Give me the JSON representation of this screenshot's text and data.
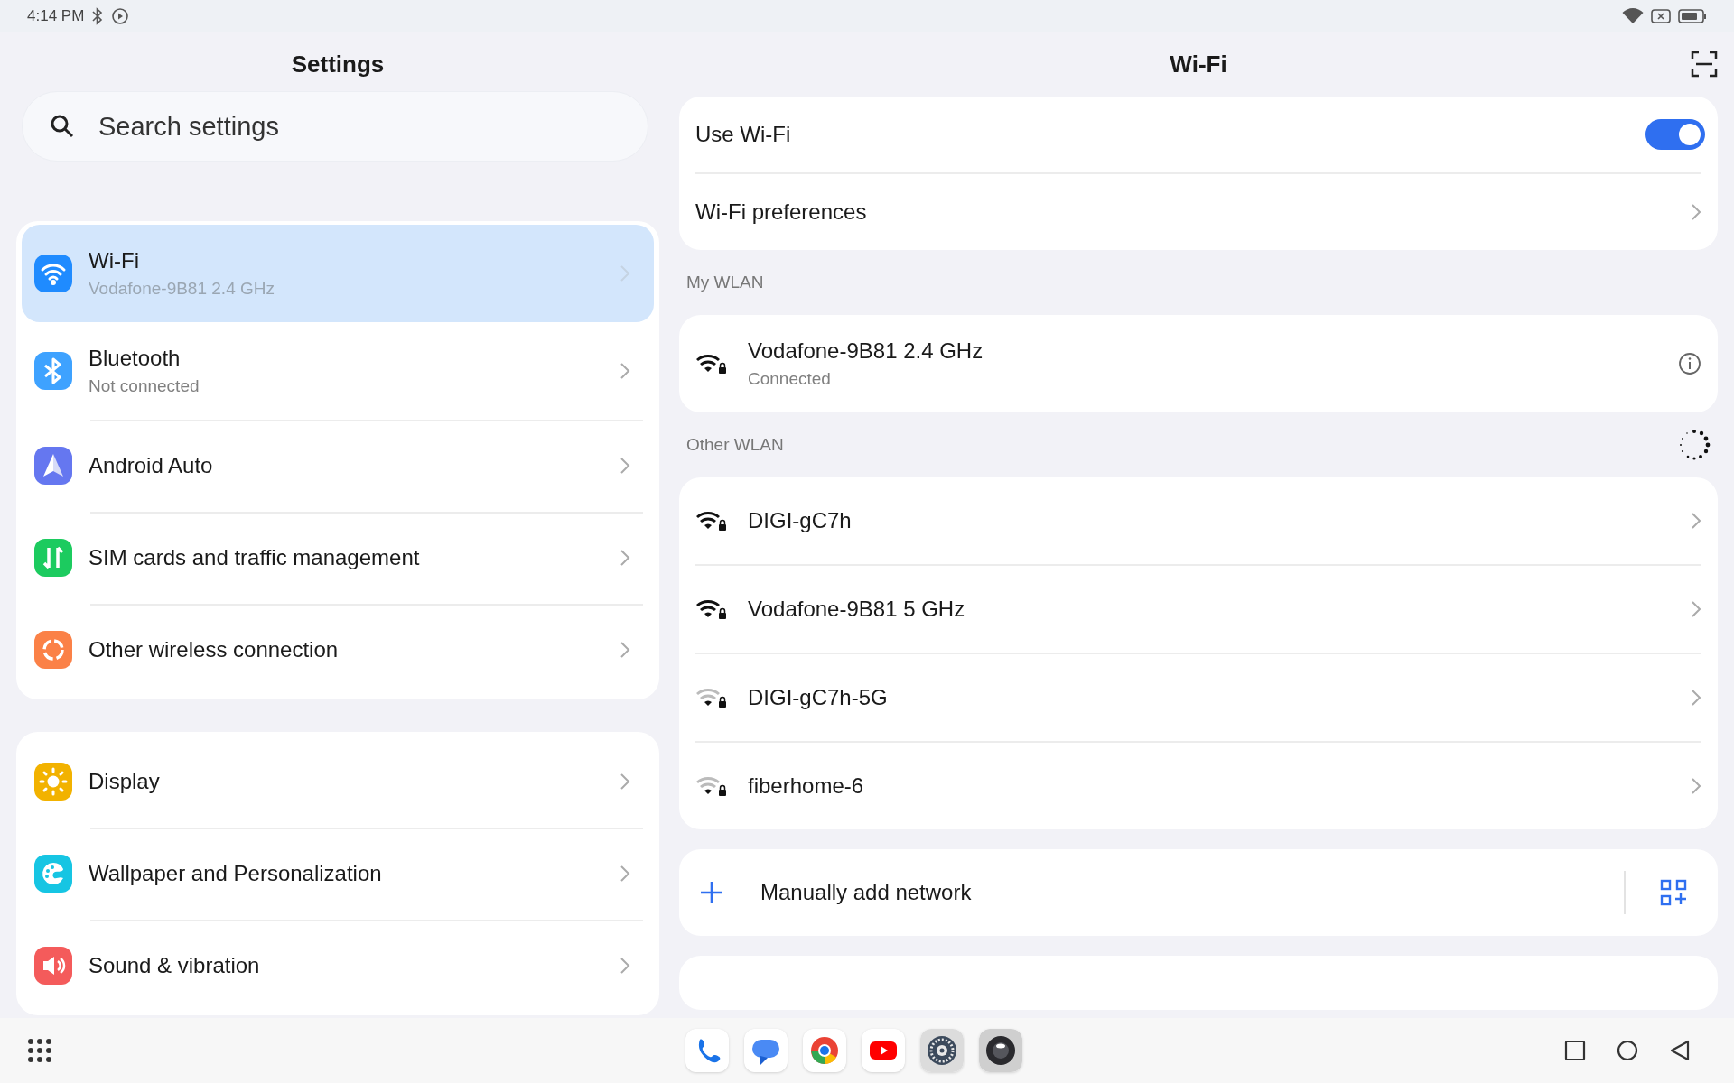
{
  "status_bar": {
    "time": "4:14 PM"
  },
  "settings": {
    "title": "Settings",
    "search": {
      "placeholder": "Search settings"
    },
    "groups": [
      {
        "items": [
          {
            "kind": "wifi",
            "label": "Wi-Fi",
            "subtitle": "Vodafone-9B81 2.4 GHz",
            "selected": true
          },
          {
            "kind": "bluetooth",
            "label": "Bluetooth",
            "subtitle": "Not connected",
            "selected": false
          },
          {
            "kind": "auto",
            "label": "Android Auto",
            "selected": false
          },
          {
            "kind": "sim",
            "label": "SIM cards and traffic management",
            "selected": false
          },
          {
            "kind": "wireless",
            "label": "Other wireless connection",
            "selected": false
          }
        ]
      },
      {
        "items": [
          {
            "kind": "display",
            "label": "Display",
            "selected": false
          },
          {
            "kind": "wallpaper",
            "label": "Wallpaper and Personalization",
            "selected": false
          },
          {
            "kind": "sound",
            "label": "Sound & vibration",
            "selected": false
          }
        ]
      }
    ]
  },
  "wifi": {
    "title": "Wi-Fi",
    "use_wifi": {
      "label": "Use Wi-Fi",
      "on": true
    },
    "preferences": "Wi-Fi preferences",
    "my_wlan": {
      "heading": "My WLAN",
      "networks": [
        {
          "name": "Vodafone-9B81 2.4 GHz",
          "status": "Connected",
          "weak": false
        }
      ]
    },
    "other_wlan": {
      "heading": "Other WLAN",
      "networks": [
        {
          "name": "DIGI-gC7h",
          "weak": false
        },
        {
          "name": "Vodafone-9B81 5 GHz",
          "weak": false
        },
        {
          "name": "DIGI-gC7h-5G",
          "weak": true
        },
        {
          "name": "fiberhome-6",
          "weak": true
        }
      ]
    },
    "add_network": "Manually add network"
  }
}
